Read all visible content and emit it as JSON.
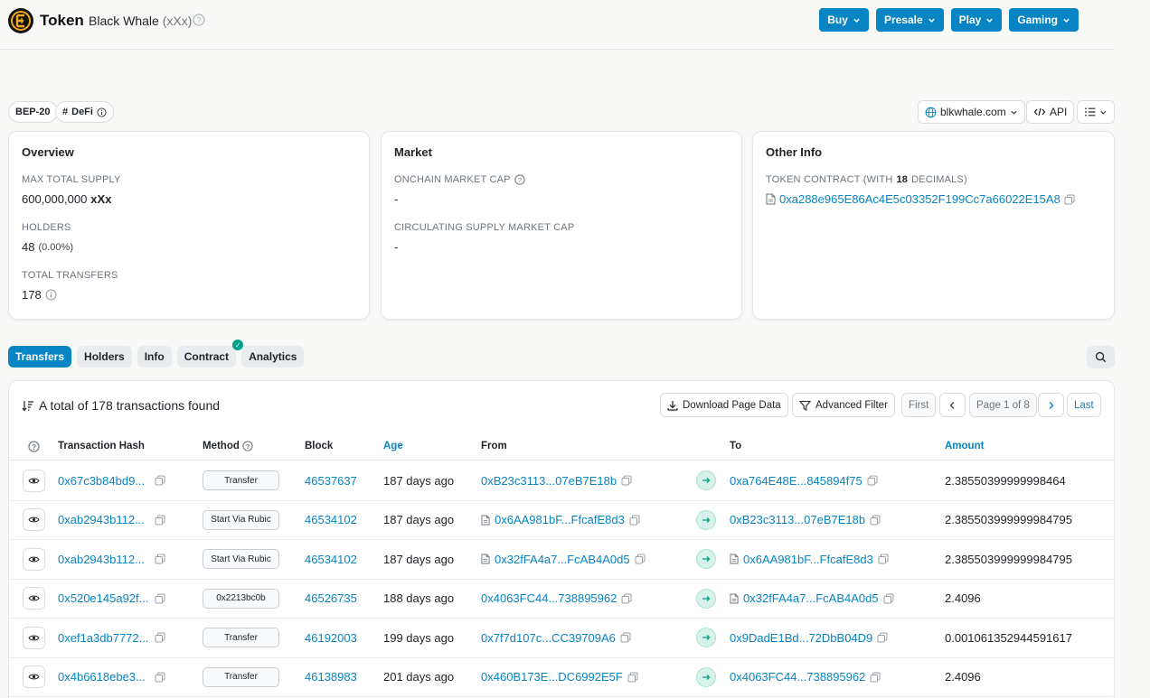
{
  "header": {
    "token_label": "Token",
    "name": "Black Whale",
    "symbol": "(xXx)",
    "nav": [
      "Buy",
      "Presale",
      "Play",
      "Gaming"
    ]
  },
  "tags": {
    "standard": "BEP-20",
    "category": "DeFi"
  },
  "tools": {
    "website": "blkwhale.com",
    "api": "API"
  },
  "overview": {
    "title": "Overview",
    "supply_label": "MAX TOTAL SUPPLY",
    "supply_value": "600,000,000",
    "supply_symbol": "xXx",
    "holders_label": "HOLDERS",
    "holders_value": "48",
    "holders_pct": "(0.00%)",
    "transfers_label": "TOTAL TRANSFERS",
    "transfers_value": "178"
  },
  "market": {
    "title": "Market",
    "mcap_label": "ONCHAIN MARKET CAP",
    "mcap_value": "-",
    "circ_label": "CIRCULATING SUPPLY MARKET CAP",
    "circ_value": "-"
  },
  "other": {
    "title": "Other Info",
    "contract_label_pre": "TOKEN CONTRACT (WITH ",
    "contract_decimals": "18",
    "contract_label_post": " DECIMALS)",
    "contract_address": "0xa288e965E86Ac4E5c03352F199Cc7a66022E15A8"
  },
  "tabs": [
    "Transfers",
    "Holders",
    "Info",
    "Contract",
    "Analytics"
  ],
  "table": {
    "summary": "A total of 178 transactions found",
    "download": "Download Page Data",
    "filter": "Advanced Filter",
    "first": "First",
    "page": "Page 1 of 8",
    "last": "Last",
    "headers": {
      "hash": "Transaction Hash",
      "method": "Method",
      "block": "Block",
      "age": "Age",
      "from": "From",
      "to": "To",
      "amount": "Amount"
    },
    "rows": [
      {
        "hash": "0x67c3b84bd9...",
        "method": "Transfer",
        "block": "46537637",
        "age": "187 days ago",
        "from": "0xB23c3113...07eB7E18b",
        "to": "0xa764E48E...845894f75",
        "amount": "2.38550399999998464"
      },
      {
        "hash": "0xab2943b112...",
        "method": "Start Via Rubic",
        "block": "46534102",
        "age": "187 days ago",
        "from": "0x6AA981bF...FfcafE8d3",
        "to": "0xB23c3113...07eB7E18b",
        "amount": "2.385503999999984795"
      },
      {
        "hash": "0xab2943b112...",
        "method": "Start Via Rubic",
        "block": "46534102",
        "age": "187 days ago",
        "from": "0x32fFA4a7...FcAB4A0d5",
        "to": "0x6AA981bF...FfcafE8d3",
        "amount": "2.385503999999984795"
      },
      {
        "hash": "0x520e145a92f...",
        "method": "0x2213bc0b",
        "block": "46526735",
        "age": "188 days ago",
        "from": "0x4063FC44...738895962",
        "to": "0x32fFA4a7...FcAB4A0d5",
        "amount": "2.4096"
      },
      {
        "hash": "0xef1a3db7772...",
        "method": "Transfer",
        "block": "46192003",
        "age": "199 days ago",
        "from": "0x7f7d107c...CC39709A6",
        "to": "0x9DadE1Bd...72DbB04D9",
        "amount": "0.001061352944591617"
      },
      {
        "hash": "0x4b6618ebe3...",
        "method": "Transfer",
        "block": "46138983",
        "age": "201 days ago",
        "from": "0x460B173E...DC6992E5F",
        "to": "0x4063FC44...738895962",
        "amount": "2.4096"
      }
    ]
  },
  "colors": {
    "accent": "#0784c3",
    "success": "#00a186"
  }
}
